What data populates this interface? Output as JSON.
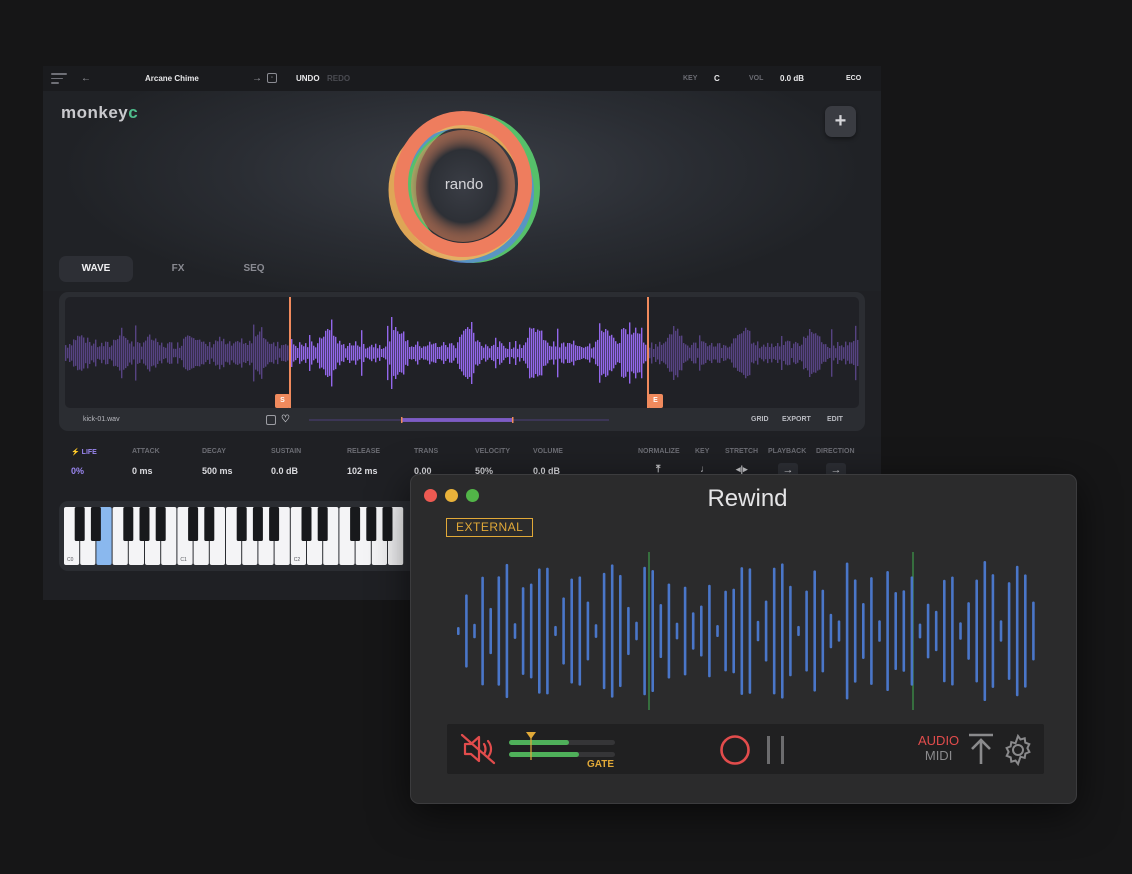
{
  "monkeyc": {
    "topbar": {
      "preset_name": "Arcane Chime",
      "undo": "UNDO",
      "redo": "REDO",
      "key_label": "KEY",
      "key_value": "C",
      "vol_label": "VOL",
      "vol_value": "0.0 dB",
      "eco": "ECO"
    },
    "logo": {
      "main": "monkey",
      "accent": "c"
    },
    "orb_label": "rando",
    "tabs": [
      "WAVE",
      "FX",
      "SEQ"
    ],
    "active_tab": "WAVE",
    "waveform": {
      "file_name": "kick-01.wav",
      "start_marker": "S",
      "end_marker": "E",
      "grid": "GRID",
      "export": "EXPORT",
      "edit": "EDIT"
    },
    "params": [
      {
        "label": "LIFE",
        "value": "0%"
      },
      {
        "label": "ATTACK",
        "value": "0 ms"
      },
      {
        "label": "DECAY",
        "value": "500 ms"
      },
      {
        "label": "SUSTAIN",
        "value": "0.0 dB"
      },
      {
        "label": "RELEASE",
        "value": "102 ms"
      },
      {
        "label": "TRANS",
        "value": "0.00"
      },
      {
        "label": "VELOCITY",
        "value": "50%"
      },
      {
        "label": "VOLUME",
        "value": "0.0 dB"
      }
    ],
    "controls": [
      {
        "label": "NORMALIZE",
        "icon": "normalize-icon"
      },
      {
        "label": "KEY",
        "icon": "note-icon"
      },
      {
        "label": "STRETCH",
        "icon": "stretch-icon"
      },
      {
        "label": "PLAYBACK",
        "icon": "arrow-right-icon"
      },
      {
        "label": "DIRECTION",
        "icon": "arrow-right-icon"
      }
    ],
    "keyboard": {
      "octave_labels": [
        "C0",
        "C1",
        "C2"
      ],
      "highlighted_key": "E0"
    },
    "colors": {
      "accent_orange": "#f08a5d",
      "wave_purple": "#9a6cf5",
      "logo_green": "#4fbd8c"
    }
  },
  "rewind": {
    "title": "Rewind",
    "source_badge": "EXTERNAL",
    "gate_label": "GATE",
    "audio_label": "AUDIO",
    "midi_label": "MIDI",
    "colors": {
      "wave_blue": "#4a76c8",
      "playhead_green": "#3e9a4a",
      "accent_amber": "#e1a938",
      "record_red": "#e24c4c"
    }
  }
}
